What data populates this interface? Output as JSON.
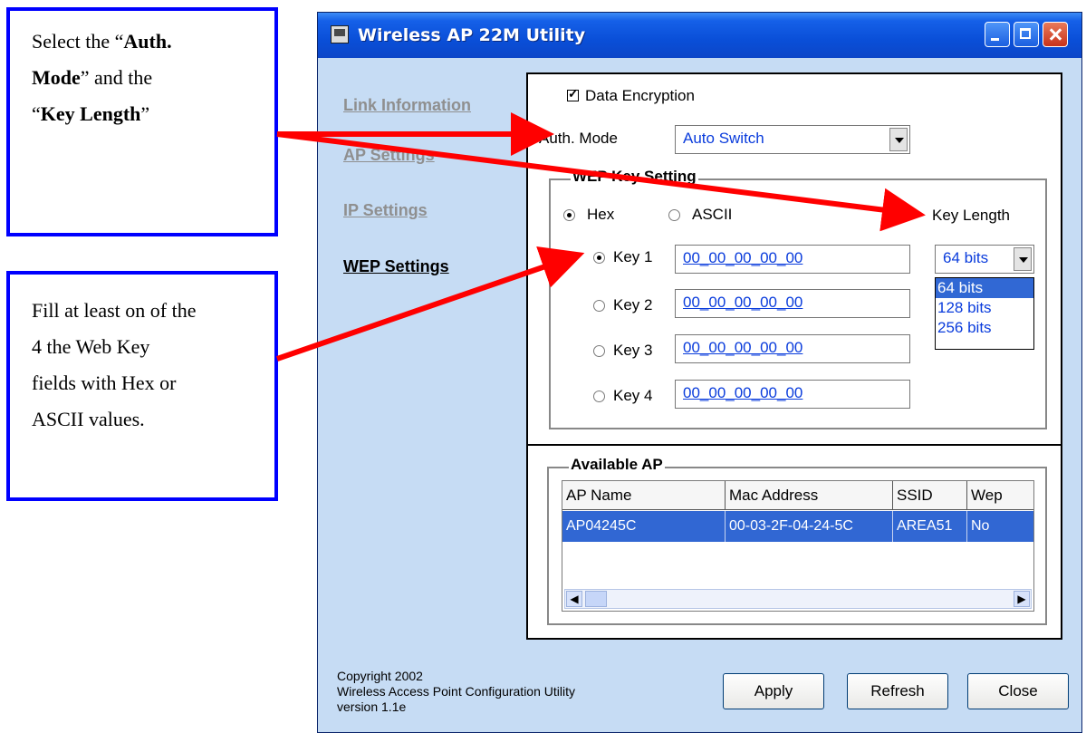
{
  "callouts": {
    "top": {
      "line1_a": "Select the “",
      "line1_b": "Auth.",
      "line2_a": "Mode",
      "line2_b": "” and the",
      "line3_a": "“",
      "line3_b": "Key Length",
      "line3_c": "”"
    },
    "bottom": {
      "lines": [
        "Fill at least on of the",
        "4 the Web Key",
        "fields with Hex or",
        "ASCII values."
      ]
    }
  },
  "window": {
    "title": "Wireless AP 22M Utility"
  },
  "nav": {
    "items": [
      "Link Information",
      "AP Settings",
      "IP Settings",
      "WEP Settings"
    ],
    "active": "WEP Settings"
  },
  "wep": {
    "data_encryption_label": "Data Encryption",
    "data_encryption_checked": true,
    "auth_mode_label": "Auth. Mode",
    "auth_mode_value": "Auto Switch",
    "group_title": "WEP Key Setting",
    "hex_label": "Hex",
    "ascii_label": "ASCII",
    "format_selected": "Hex",
    "key_length_label": "Key Length",
    "key_length_value": "64 bits",
    "key_length_options": [
      "64 bits",
      "128 bits",
      "256 bits"
    ],
    "keys": [
      {
        "label": "Key 1",
        "value": "00_00_00_00_00",
        "selected": true
      },
      {
        "label": "Key 2",
        "value": "00_00_00_00_00",
        "selected": false
      },
      {
        "label": "Key 3",
        "value": "00_00_00_00_00",
        "selected": false
      },
      {
        "label": "Key 4",
        "value": "00_00_00_00_00",
        "selected": false
      }
    ]
  },
  "available_ap": {
    "title": "Available AP",
    "columns": [
      "AP Name",
      "Mac Address",
      "SSID",
      "Wep"
    ],
    "rows": [
      [
        "AP04245C",
        "00-03-2F-04-24-5C",
        "AREA51",
        "No"
      ]
    ]
  },
  "footer": {
    "copyright": "Copyright 2002",
    "product": "Wireless Access Point Configuration Utility",
    "version": "version 1.1e"
  },
  "buttons": {
    "apply": "Apply",
    "refresh": "Refresh",
    "close": "Close"
  },
  "colors": {
    "callout_border": "#0000ff",
    "arrow": "#ff0000",
    "title_bar": "#0a4fd8",
    "window_bg": "#c6dcf4",
    "selection": "#3167d3"
  }
}
